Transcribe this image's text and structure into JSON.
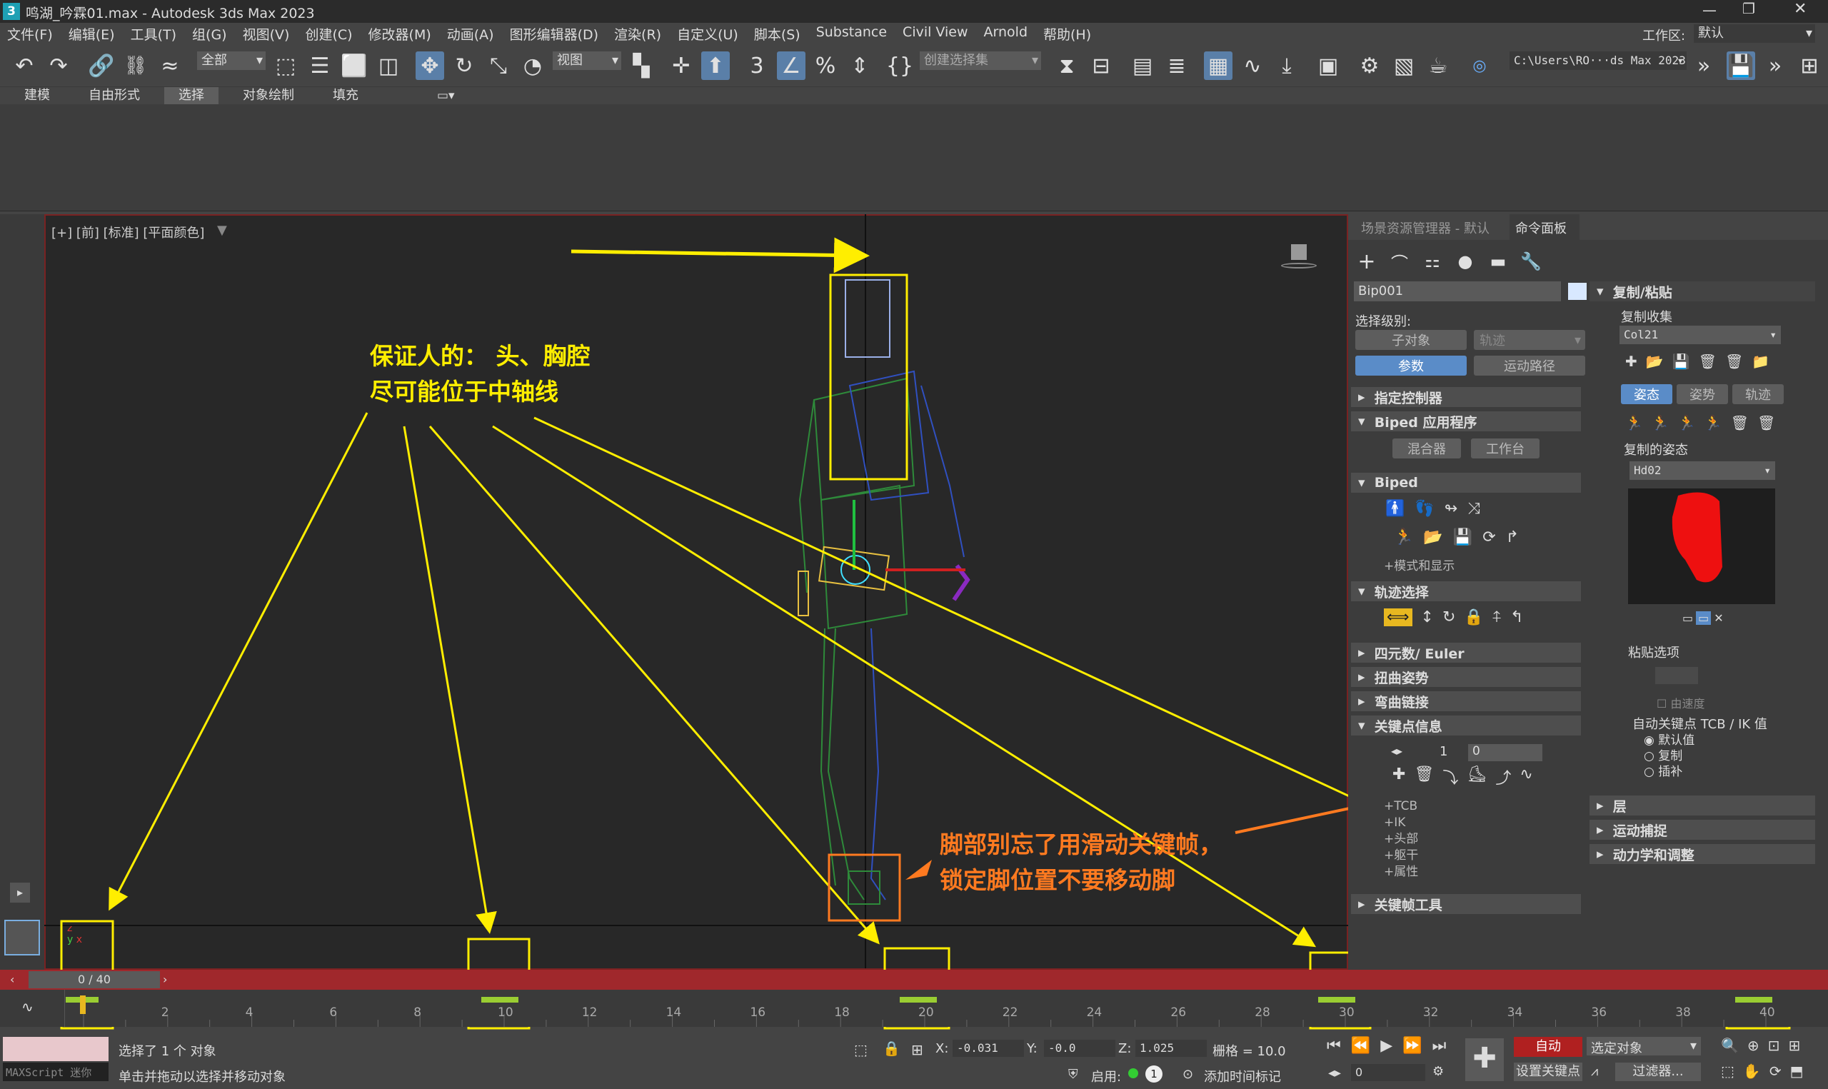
{
  "window": {
    "title": "鸣湖_吟霖01.max - Autodesk 3ds Max 2023",
    "app_icon": "3"
  },
  "menubar": [
    "文件(F)",
    "编辑(E)",
    "工具(T)",
    "组(G)",
    "视图(V)",
    "创建(C)",
    "修改器(M)",
    "动画(A)",
    "图形编辑器(D)",
    "渲染(R)",
    "自定义(U)",
    "脚本(S)",
    "Substance",
    "Civil View",
    "Arnold",
    "帮助(H)"
  ],
  "workspace": {
    "label": "工作区:",
    "value": "默认"
  },
  "toolbar": {
    "filter": "全部",
    "coord": "视图",
    "selection_set": "创建选择集",
    "path": "C:\\Users\\RO···ds Max 2023"
  },
  "ribbon_tabs": [
    "建模",
    "自由形式",
    "选择",
    "对象绘制",
    "填充"
  ],
  "viewport": {
    "label": "[+] [前] [标准] [平面颜色]"
  },
  "annotations": {
    "yellow_note_line1": "保证人的：  头、胸腔",
    "yellow_note_line2": "尽可能位于中轴线",
    "orange_note_line1": "脚部别忘了用滑动关键帧，",
    "orange_note_line2": "锁定脚位置不要移动脚",
    "colors": {
      "yellow": "#ffee00",
      "orange": "#ff7a20"
    }
  },
  "panel": {
    "tabs": [
      "场景资源管理器 - 默认",
      "命令面板"
    ],
    "object_name": "Bip001",
    "select_level_label": "选择级别:",
    "sub_object": "子对象",
    "track": "轨迹",
    "params": "参数",
    "motion_path": "运动路径",
    "sections": [
      "指定控制器",
      "Biped 应用程序",
      "Biped",
      "轨迹选择",
      "四元数/ Euler",
      "扭曲姿势",
      "弯曲链接",
      "关键点信息",
      "关键帧工具"
    ],
    "mixer": "混合器",
    "workbench": "工作台",
    "mode_display": "+模式和显示",
    "key_number": "1",
    "key_time": "0",
    "key_subs": [
      "+TCB",
      "+IK",
      "+头部",
      "+躯干",
      "+属性"
    ]
  },
  "copy_paste": {
    "title": "复制/粘贴",
    "collection_label": "复制收集",
    "collection_value": "Col21",
    "tabs": [
      "姿态",
      "姿势",
      "轨迹"
    ],
    "copied_pose_label": "复制的姿态",
    "pose_value": "Hd02",
    "paste_options": "粘贴选项",
    "by_velocity": "由速度",
    "auto_key_label": "自动关键点 TCB / IK 值",
    "radio": [
      "默认值",
      "复制",
      "插补"
    ],
    "rollouts": [
      "层",
      "运动捕捉",
      "动力学和调整"
    ]
  },
  "timeline": {
    "frame": "0 / 40",
    "ticks": [
      "2",
      "4",
      "6",
      "8",
      "10",
      "12",
      "14",
      "16",
      "18",
      "20",
      "22",
      "24",
      "26",
      "28",
      "30",
      "32",
      "34",
      "36",
      "38",
      "40"
    ]
  },
  "status": {
    "maxscript": "MAXScript 迷你",
    "selected": "选择了 1 个 对象",
    "hint": "单击并拖动以选择并移动对象",
    "x": "-0.031",
    "y": "-0.0",
    "z": "1.025",
    "grid": "栅格 = 10.0",
    "enable": "启用:",
    "add_time_tag": "添加时间标记",
    "auto": "自动",
    "selected_obj": "选定对象",
    "set_key": "设置关键点",
    "filters": "过滤器...",
    "time_field": "0"
  }
}
